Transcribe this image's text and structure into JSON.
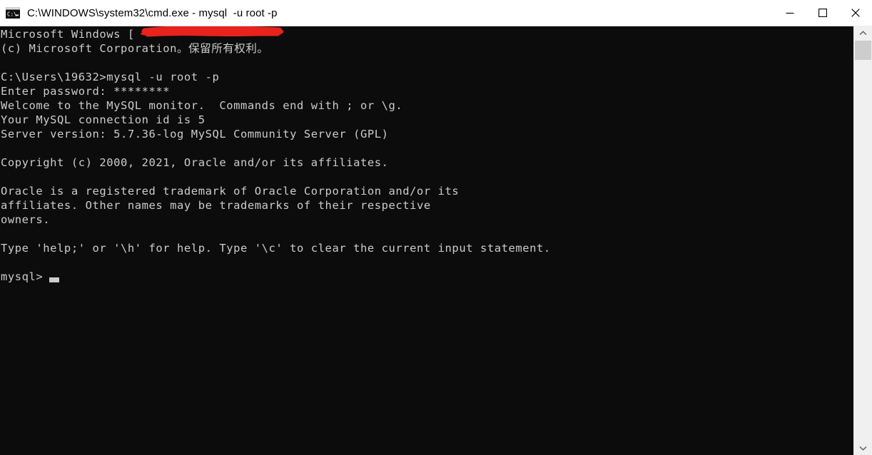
{
  "window": {
    "title": "C:\\WINDOWS\\system32\\cmd.exe - mysql  -u root -p",
    "icon": "cmd-console-icon",
    "background_color": "#0c0c0c",
    "titlebar_color": "#ffffff",
    "text_color": "#cccccc",
    "controls": {
      "minimize_label": "Minimize",
      "maximize_label": "Maximize",
      "close_label": "Close"
    }
  },
  "terminal": {
    "lines": [
      {
        "id": "line-1",
        "text": "Microsoft Windows [",
        "redacted": true
      },
      {
        "id": "line-2",
        "text": "(c) Microsoft Corporation。保留所有权利。"
      },
      {
        "id": "line-3",
        "text": ""
      },
      {
        "id": "line-4",
        "text": "C:\\Users\\19632>mysql -u root -p"
      },
      {
        "id": "line-5",
        "text": "Enter password: ********"
      },
      {
        "id": "line-6",
        "text": "Welcome to the MySQL monitor.  Commands end with ; or \\g."
      },
      {
        "id": "line-7",
        "text": "Your MySQL connection id is 5"
      },
      {
        "id": "line-8",
        "text": "Server version: 5.7.36-log MySQL Community Server (GPL)"
      },
      {
        "id": "line-9",
        "text": ""
      },
      {
        "id": "line-10",
        "text": "Copyright (c) 2000, 2021, Oracle and/or its affiliates."
      },
      {
        "id": "line-11",
        "text": ""
      },
      {
        "id": "line-12",
        "text": "Oracle is a registered trademark of Oracle Corporation and/or its"
      },
      {
        "id": "line-13",
        "text": "affiliates. Other names may be trademarks of their respective"
      },
      {
        "id": "line-14",
        "text": "owners."
      },
      {
        "id": "line-15",
        "text": ""
      },
      {
        "id": "line-16",
        "text": "Type 'help;' or '\\h' for help. Type '\\c' to clear the current input statement."
      },
      {
        "id": "line-17",
        "text": ""
      },
      {
        "id": "line-18",
        "text": "mysql>",
        "cursor": true
      }
    ],
    "redaction_color": "#e8221c",
    "prompt": "mysql>"
  },
  "scrollbar": {
    "up_arrow": "chevron-up-icon",
    "down_arrow": "chevron-down-icon",
    "thumb_label": "scrollbar-thumb"
  }
}
